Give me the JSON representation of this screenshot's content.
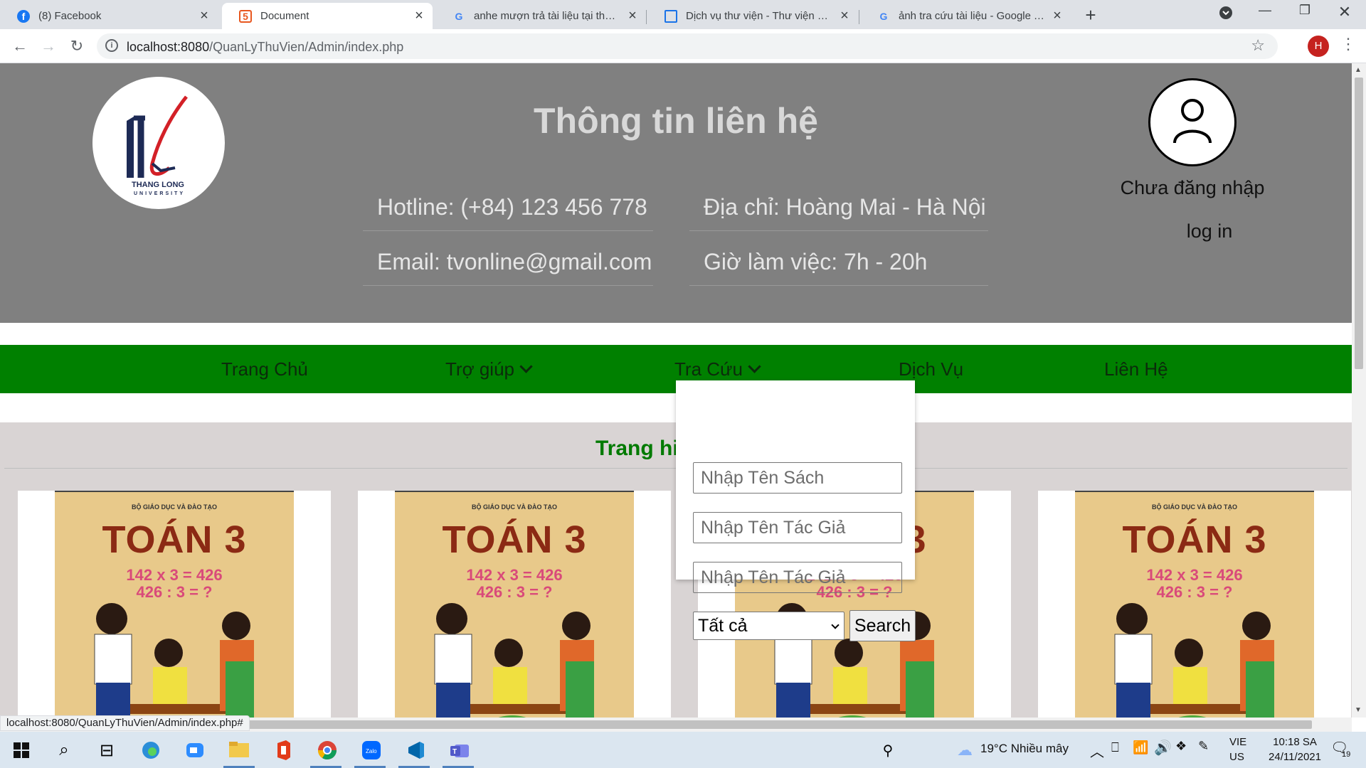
{
  "browser": {
    "tabs": [
      {
        "label": "(8) Facebook",
        "icon": "facebook-icon"
      },
      {
        "label": "Document",
        "icon": "document-icon"
      },
      {
        "label": "anhe mượn trả tài liệu tại thư viện",
        "icon": "google-icon"
      },
      {
        "label": "Dịch vụ thư viện - Thư viện Sư phạm",
        "icon": "library-icon"
      },
      {
        "label": "ảnh tra cứu tài liệu - Google Tìm kiếm",
        "icon": "google-icon"
      }
    ],
    "url_host": "localhost:8080",
    "url_path": "/QuanLyThuVien/Admin/index.php",
    "profile_initial": "H",
    "status_url": "localhost:8080/QuanLyThuVien/Admin/index.php#"
  },
  "header": {
    "logo_text_1": "THANG LONG",
    "logo_text_2": "UNIVERSITY",
    "contact_title": "Thông tin liên hệ",
    "hotline": "Hotline: (+84) 123 456 778",
    "address": "Địa chỉ: Hoàng Mai - Hà Nội",
    "email": "Email: tvonline@gmail.com",
    "hours": "Giờ làm việc: 7h - 20h",
    "user_status": "Chưa đăng nhập",
    "login": "log in"
  },
  "nav": {
    "home": "Trang Chủ",
    "help": "Trợ giúp",
    "lookup": "Tra Cứu",
    "service": "Dịch Vụ",
    "contact": "Liên Hệ"
  },
  "search_dropdown": {
    "book_placeholder": "Nhập Tên Sách",
    "author_placeholder": "Nhập Tên Tác Giả",
    "author2_placeholder": "Nhập Tên Tác Giả",
    "category_selected": "Tất cả",
    "search_button": "Search"
  },
  "content": {
    "section_title_visible": "Trang hi",
    "book_publisher": "BỘ GIÁO DỤC VÀ ĐÀO TẠO",
    "book_title": "TOÁN 3",
    "book_eq1": "142 x 3 = 426",
    "book_eq2": "426 : 3 = ?"
  },
  "taskbar": {
    "weather": "19°C  Nhiều mây",
    "lang_1": "VIE",
    "lang_2": "US",
    "time": "10:18 SA",
    "date": "24/11/2021",
    "notifications": "19"
  }
}
